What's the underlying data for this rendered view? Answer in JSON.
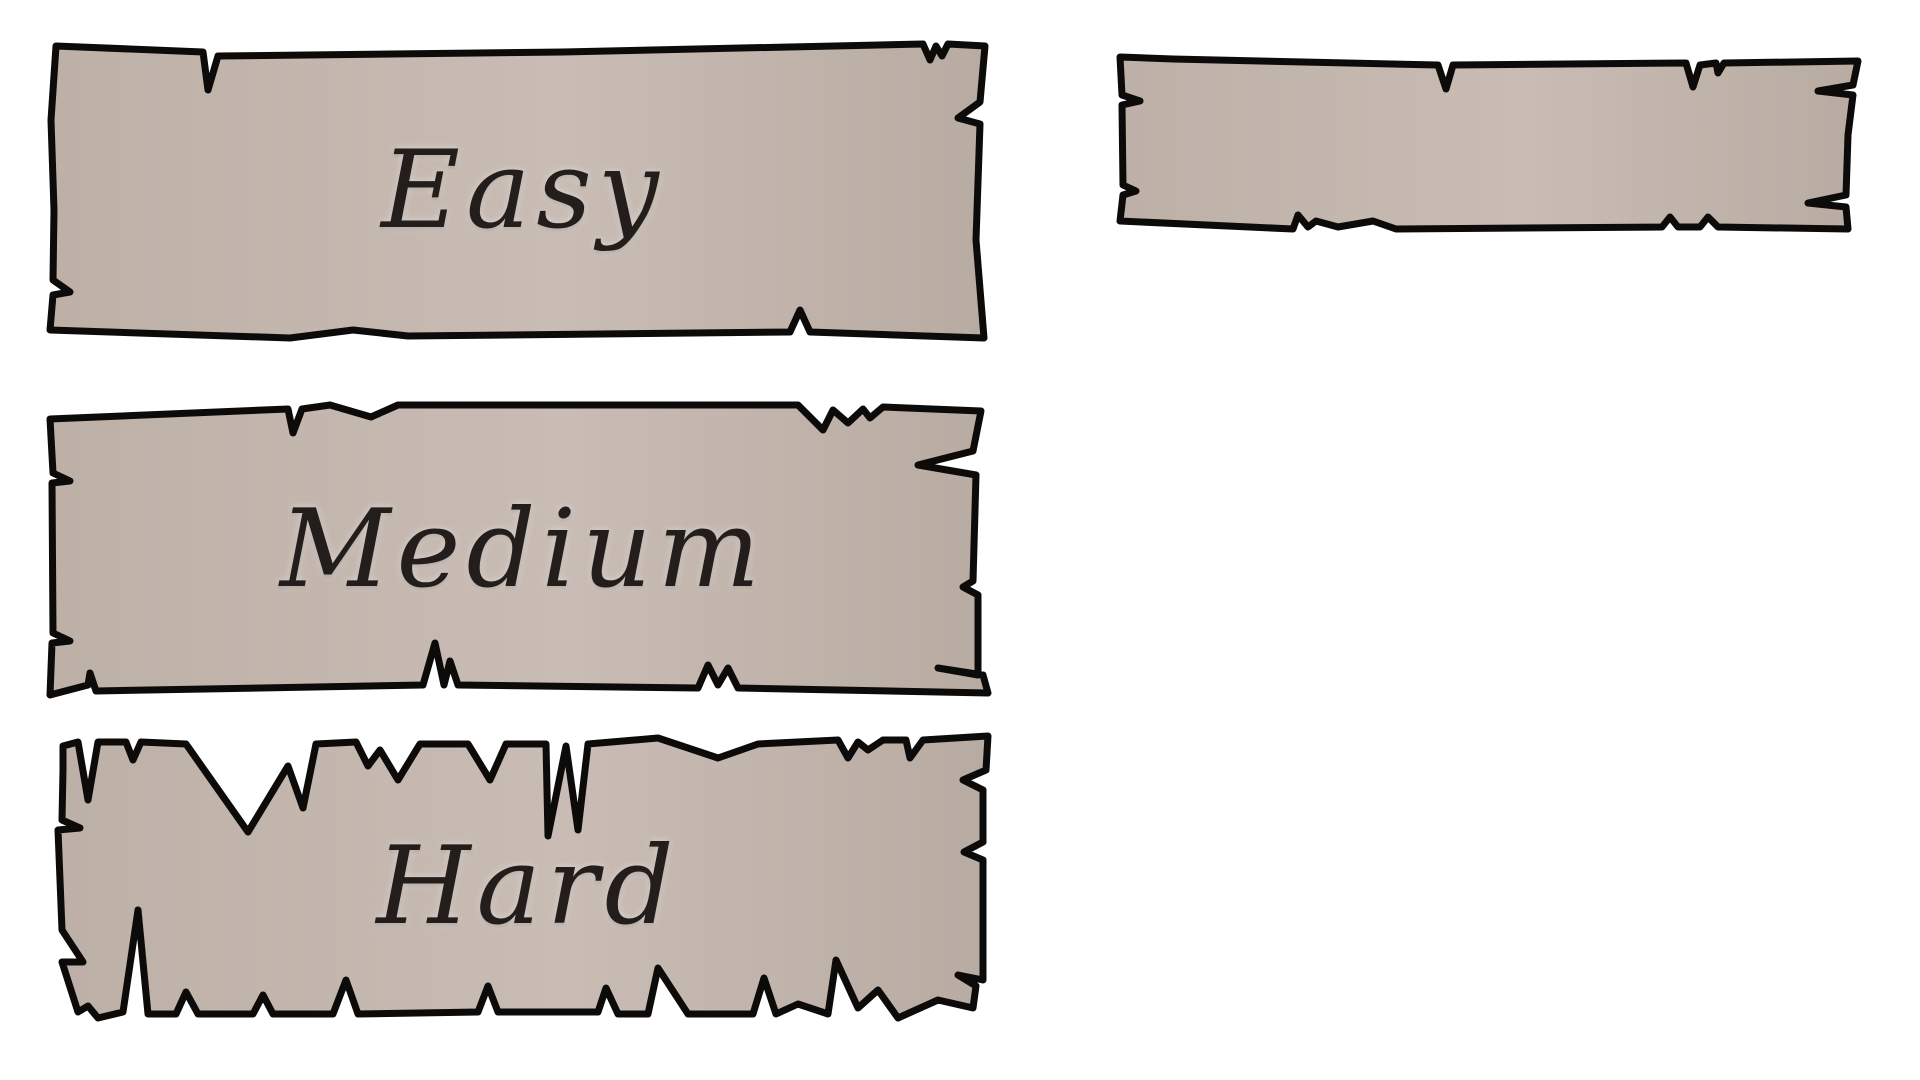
{
  "menu": {
    "buttons": [
      {
        "id": "easy",
        "label": "Easy"
      },
      {
        "id": "medium",
        "label": "Medium"
      },
      {
        "id": "hard",
        "label": "Hard"
      }
    ],
    "blank_plank_label": ""
  },
  "colors": {
    "plank_fill_light": "#c8bcb4",
    "plank_fill_dark": "#b9aca3",
    "outline": "#0d0b0a",
    "text": "#231e1c",
    "background": "#ffffff"
  }
}
